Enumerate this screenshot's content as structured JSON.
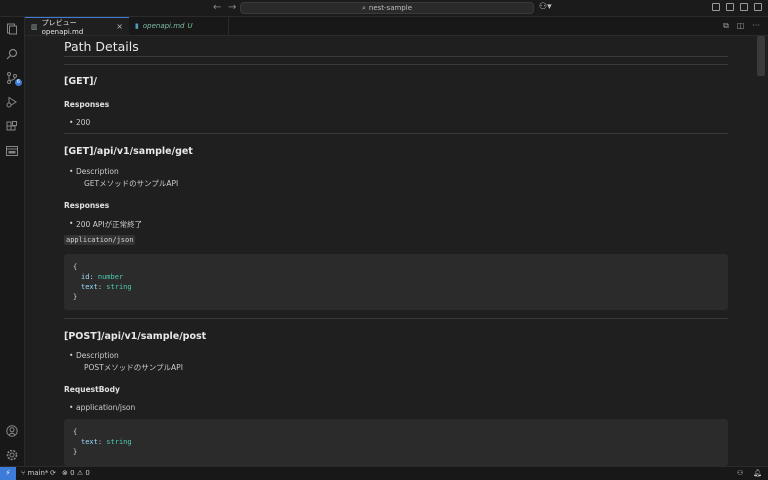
{
  "titlebar": {
    "back": "←",
    "forward": "→",
    "search": "nest-sample"
  },
  "tabs": [
    {
      "label": "プレビュー openapi.md",
      "close": "×"
    },
    {
      "label": "openapi.md",
      "modified": "U"
    }
  ],
  "doc": {
    "title": "Path Details",
    "sections": [
      {
        "heading": "[GET]/",
        "responses_label": "Responses",
        "responses": [
          "200"
        ]
      },
      {
        "heading": "[GET]/api/v1/sample/get",
        "description_label": "Description",
        "description": "GETメソッドのサンプルAPI",
        "responses_label": "Responses",
        "responses": [
          "200 APIが正常終了"
        ],
        "content_type": "application/json",
        "code": {
          "open": "{",
          "fields": [
            {
              "key": "id",
              "type": "number"
            },
            {
              "key": "text",
              "type": "string"
            }
          ],
          "close": "}"
        }
      },
      {
        "heading": "[POST]/api/v1/sample/post",
        "description_label": "Description",
        "description": "POSTメソッドのサンプルAPI",
        "body_label": "RequestBody",
        "body_items": [
          "application/json"
        ],
        "code": {
          "open": "{",
          "fields": [
            {
              "key": "text",
              "type": "string"
            }
          ],
          "close": "}"
        }
      }
    ]
  },
  "statusbar": {
    "remote": "⚡",
    "branch": "main*",
    "problems": "0",
    "warnings": "0"
  },
  "colors": {
    "accent": "#3c7bd8",
    "background": "#1f1f1f",
    "code_bg": "#2b2b2b"
  }
}
